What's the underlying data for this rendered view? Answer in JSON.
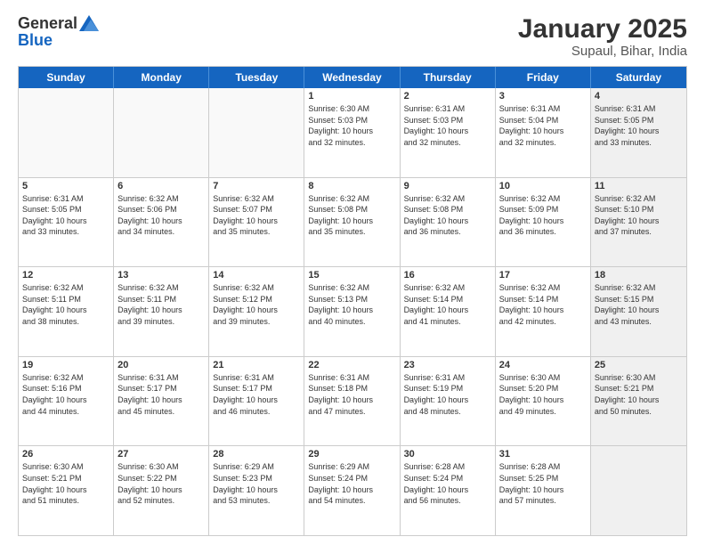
{
  "header": {
    "logo_line1": "General",
    "logo_line2": "Blue",
    "month_title": "January 2025",
    "location": "Supaul, Bihar, India"
  },
  "day_headers": [
    "Sunday",
    "Monday",
    "Tuesday",
    "Wednesday",
    "Thursday",
    "Friday",
    "Saturday"
  ],
  "weeks": [
    [
      {
        "day": "",
        "info": "",
        "empty": true
      },
      {
        "day": "",
        "info": "",
        "empty": true
      },
      {
        "day": "",
        "info": "",
        "empty": true
      },
      {
        "day": "1",
        "info": "Sunrise: 6:30 AM\nSunset: 5:03 PM\nDaylight: 10 hours\nand 32 minutes."
      },
      {
        "day": "2",
        "info": "Sunrise: 6:31 AM\nSunset: 5:03 PM\nDaylight: 10 hours\nand 32 minutes."
      },
      {
        "day": "3",
        "info": "Sunrise: 6:31 AM\nSunset: 5:04 PM\nDaylight: 10 hours\nand 32 minutes."
      },
      {
        "day": "4",
        "info": "Sunrise: 6:31 AM\nSunset: 5:05 PM\nDaylight: 10 hours\nand 33 minutes.",
        "shaded": true
      }
    ],
    [
      {
        "day": "5",
        "info": "Sunrise: 6:31 AM\nSunset: 5:05 PM\nDaylight: 10 hours\nand 33 minutes."
      },
      {
        "day": "6",
        "info": "Sunrise: 6:32 AM\nSunset: 5:06 PM\nDaylight: 10 hours\nand 34 minutes."
      },
      {
        "day": "7",
        "info": "Sunrise: 6:32 AM\nSunset: 5:07 PM\nDaylight: 10 hours\nand 35 minutes."
      },
      {
        "day": "8",
        "info": "Sunrise: 6:32 AM\nSunset: 5:08 PM\nDaylight: 10 hours\nand 35 minutes."
      },
      {
        "day": "9",
        "info": "Sunrise: 6:32 AM\nSunset: 5:08 PM\nDaylight: 10 hours\nand 36 minutes."
      },
      {
        "day": "10",
        "info": "Sunrise: 6:32 AM\nSunset: 5:09 PM\nDaylight: 10 hours\nand 36 minutes."
      },
      {
        "day": "11",
        "info": "Sunrise: 6:32 AM\nSunset: 5:10 PM\nDaylight: 10 hours\nand 37 minutes.",
        "shaded": true
      }
    ],
    [
      {
        "day": "12",
        "info": "Sunrise: 6:32 AM\nSunset: 5:11 PM\nDaylight: 10 hours\nand 38 minutes."
      },
      {
        "day": "13",
        "info": "Sunrise: 6:32 AM\nSunset: 5:11 PM\nDaylight: 10 hours\nand 39 minutes."
      },
      {
        "day": "14",
        "info": "Sunrise: 6:32 AM\nSunset: 5:12 PM\nDaylight: 10 hours\nand 39 minutes."
      },
      {
        "day": "15",
        "info": "Sunrise: 6:32 AM\nSunset: 5:13 PM\nDaylight: 10 hours\nand 40 minutes."
      },
      {
        "day": "16",
        "info": "Sunrise: 6:32 AM\nSunset: 5:14 PM\nDaylight: 10 hours\nand 41 minutes."
      },
      {
        "day": "17",
        "info": "Sunrise: 6:32 AM\nSunset: 5:14 PM\nDaylight: 10 hours\nand 42 minutes."
      },
      {
        "day": "18",
        "info": "Sunrise: 6:32 AM\nSunset: 5:15 PM\nDaylight: 10 hours\nand 43 minutes.",
        "shaded": true
      }
    ],
    [
      {
        "day": "19",
        "info": "Sunrise: 6:32 AM\nSunset: 5:16 PM\nDaylight: 10 hours\nand 44 minutes."
      },
      {
        "day": "20",
        "info": "Sunrise: 6:31 AM\nSunset: 5:17 PM\nDaylight: 10 hours\nand 45 minutes."
      },
      {
        "day": "21",
        "info": "Sunrise: 6:31 AM\nSunset: 5:17 PM\nDaylight: 10 hours\nand 46 minutes."
      },
      {
        "day": "22",
        "info": "Sunrise: 6:31 AM\nSunset: 5:18 PM\nDaylight: 10 hours\nand 47 minutes."
      },
      {
        "day": "23",
        "info": "Sunrise: 6:31 AM\nSunset: 5:19 PM\nDaylight: 10 hours\nand 48 minutes."
      },
      {
        "day": "24",
        "info": "Sunrise: 6:30 AM\nSunset: 5:20 PM\nDaylight: 10 hours\nand 49 minutes."
      },
      {
        "day": "25",
        "info": "Sunrise: 6:30 AM\nSunset: 5:21 PM\nDaylight: 10 hours\nand 50 minutes.",
        "shaded": true
      }
    ],
    [
      {
        "day": "26",
        "info": "Sunrise: 6:30 AM\nSunset: 5:21 PM\nDaylight: 10 hours\nand 51 minutes."
      },
      {
        "day": "27",
        "info": "Sunrise: 6:30 AM\nSunset: 5:22 PM\nDaylight: 10 hours\nand 52 minutes."
      },
      {
        "day": "28",
        "info": "Sunrise: 6:29 AM\nSunset: 5:23 PM\nDaylight: 10 hours\nand 53 minutes."
      },
      {
        "day": "29",
        "info": "Sunrise: 6:29 AM\nSunset: 5:24 PM\nDaylight: 10 hours\nand 54 minutes."
      },
      {
        "day": "30",
        "info": "Sunrise: 6:28 AM\nSunset: 5:24 PM\nDaylight: 10 hours\nand 56 minutes."
      },
      {
        "day": "31",
        "info": "Sunrise: 6:28 AM\nSunset: 5:25 PM\nDaylight: 10 hours\nand 57 minutes."
      },
      {
        "day": "",
        "info": "",
        "empty": true,
        "shaded": true
      }
    ]
  ]
}
